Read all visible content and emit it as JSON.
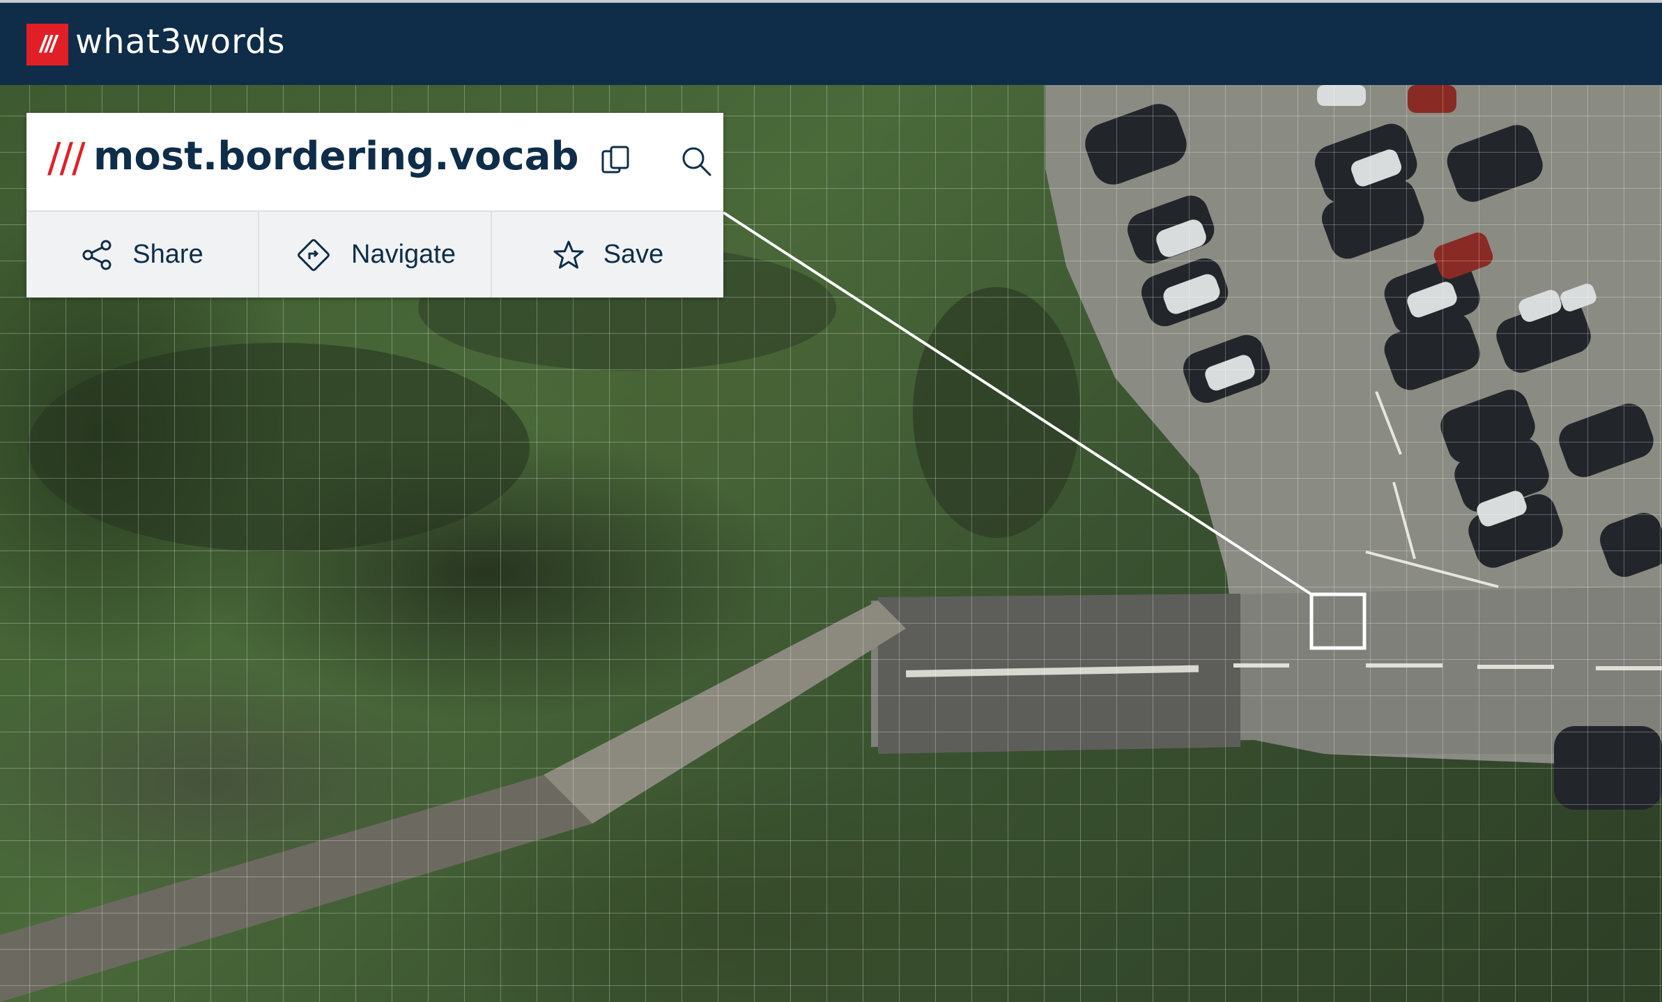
{
  "header": {
    "logo_text": "///",
    "brand": "what3words"
  },
  "address_panel": {
    "slashes": "///",
    "words": "most.bordering.vocab",
    "copy_icon": "copy-icon",
    "search_icon": "search-icon",
    "actions": [
      {
        "label": "Share",
        "icon": "share-icon"
      },
      {
        "label": "Navigate",
        "icon": "navigate-icon"
      },
      {
        "label": "Save",
        "icon": "star-icon"
      }
    ]
  },
  "map": {
    "type": "satellite",
    "grid": true
  },
  "colors": {
    "header_bg": "#0f2d48",
    "brand_red": "#e11f26",
    "text_dark": "#0f2d48"
  }
}
